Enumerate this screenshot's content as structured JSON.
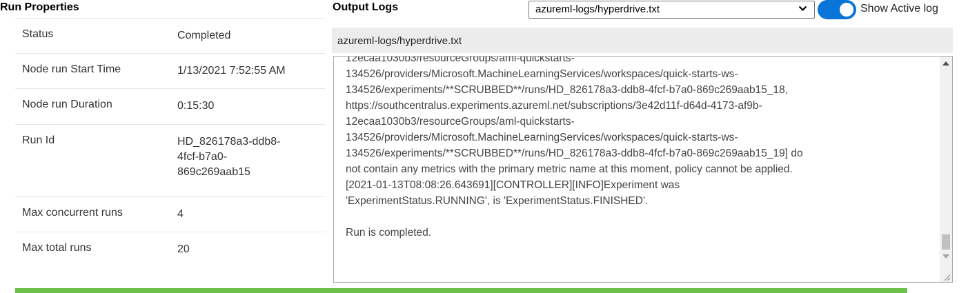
{
  "run_properties": {
    "title": "Run Properties",
    "rows": [
      {
        "key": "Status",
        "value": "Completed"
      },
      {
        "key": "Node run Start Time",
        "value": "1/13/2021 7:52:55 AM"
      },
      {
        "key": "Node run Duration",
        "value": "0:15:30"
      },
      {
        "key": "Run Id",
        "value": "HD_826178a3-ddb8-\n4fcf-b7a0-\n869c269aab15"
      },
      {
        "key": "Max concurrent runs",
        "value": "4"
      },
      {
        "key": "Max total runs",
        "value": "20"
      }
    ]
  },
  "output_logs": {
    "title": "Output Logs",
    "selected_log": "azureml-logs/hyperdrive.txt",
    "toggle_label": "Show Active log",
    "toggle_on": true,
    "header_filename": "azureml-logs/hyperdrive.txt",
    "log_text": "12ecaa1030b3/resourceGroups/aml-quickstarts-\n134526/providers/Microsoft.MachineLearningServices/workspaces/quick-starts-ws-\n134526/experiments/**SCRUBBED**/runs/HD_826178a3-ddb8-4fcf-b7a0-869c269aab15_18,\nhttps://southcentralus.experiments.azureml.net/subscriptions/3e42d11f-d64d-4173-af9b-\n12ecaa1030b3/resourceGroups/aml-quickstarts-\n134526/providers/Microsoft.MachineLearningServices/workspaces/quick-starts-ws-\n134526/experiments/**SCRUBBED**/runs/HD_826178a3-ddb8-4fcf-b7a0-869c269aab15_19] do\nnot contain any metrics with the primary metric name at this moment, policy cannot be applied.\n[2021-01-13T08:08:26.643691][CONTROLLER][INFO]Experiment was\n'ExperimentStatus.RUNNING', is 'ExperimentStatus.FINISHED'.\n\nRun is completed."
  },
  "colors": {
    "toggle_accent": "#0a75d8",
    "progress_bar": "#6cc04a",
    "log_header_bg": "#ececec"
  }
}
